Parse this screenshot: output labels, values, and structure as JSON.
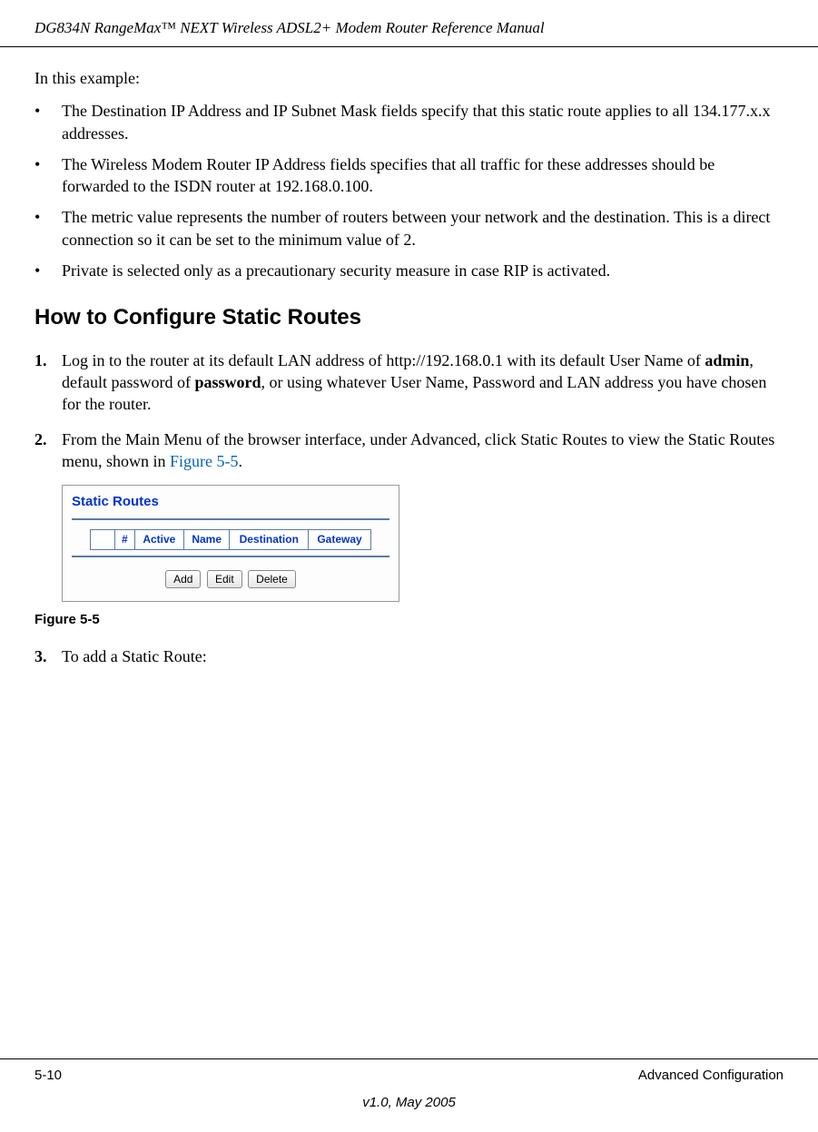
{
  "header": {
    "title": "DG834N RangeMax™ NEXT Wireless ADSL2+ Modem Router Reference Manual"
  },
  "intro": "In this example:",
  "bullets": [
    "The Destination IP Address and IP Subnet Mask fields specify that this static route applies to all 134.177.x.x addresses.",
    "The Wireless Modem Router IP Address fields specifies that all traffic for these addresses should be forwarded to the ISDN router at 192.168.0.100.",
    "The metric value represents the number of routers between your network and the destination. This is a direct connection so it can be set to the minimum value of 2.",
    "Private is selected only as a precautionary security measure in case RIP is activated."
  ],
  "section_heading": "How to Configure Static Routes",
  "steps": {
    "s1": {
      "num": "1.",
      "before_admin": "Log in to the router at its default LAN address of http://192.168.0.1 with its default User Name of ",
      "admin": "admin",
      "mid": ", default password of ",
      "password": "password",
      "after": ", or using whatever User Name, Password and LAN address you have chosen for the router."
    },
    "s2": {
      "num": "2.",
      "before_link": "From the Main Menu of the browser interface, under Advanced, click Static Routes to view the Static Routes menu, shown in ",
      "link": "Figure 5-5",
      "after_link": "."
    },
    "s3": {
      "num": "3.",
      "text": "To add a Static Route:"
    }
  },
  "figure": {
    "title": "Static Routes",
    "headers": {
      "hash": "#",
      "active": "Active",
      "name": "Name",
      "dest": "Destination",
      "gw": "Gateway"
    },
    "buttons": {
      "add": "Add",
      "edit": "Edit",
      "delete": "Delete"
    },
    "caption": "Figure 5-5"
  },
  "footer": {
    "page": "5-10",
    "section": "Advanced Configuration",
    "version": "v1.0, May 2005"
  }
}
